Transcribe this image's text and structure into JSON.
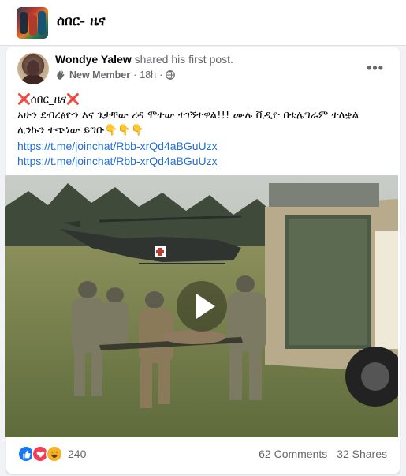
{
  "group": {
    "title": "ሰበር- ዜና"
  },
  "post": {
    "author_name": "Wondye Yalew",
    "action_text": "shared his first post.",
    "badge": "New Member",
    "time": "18h",
    "more_label": "•••",
    "lines": [
      "❌ሰበር_ዜና❌",
      "አሁን ደብረፅዮን እና ጌታቸው ረዳ ሞተው ተገኝተዋል!!! ሙሉ ቪዲዮ በቴሌግራም ተለቋል",
      "ሊንኩን ተጭነው ይግቡ👇👇👇"
    ],
    "links": [
      "https://t.me/joinchat/Rbb-xrQd4aBGuUzx",
      "https://t.me/joinchat/Rbb-xrQd4aBGuUzx"
    ]
  },
  "footer": {
    "reaction_count": "240",
    "comments": "62 Comments",
    "shares": "32 Shares"
  },
  "icons": {
    "privacy": "globe-icon",
    "member": "hand-wave-icon",
    "more": "more-dots-icon",
    "play": "play-icon"
  }
}
